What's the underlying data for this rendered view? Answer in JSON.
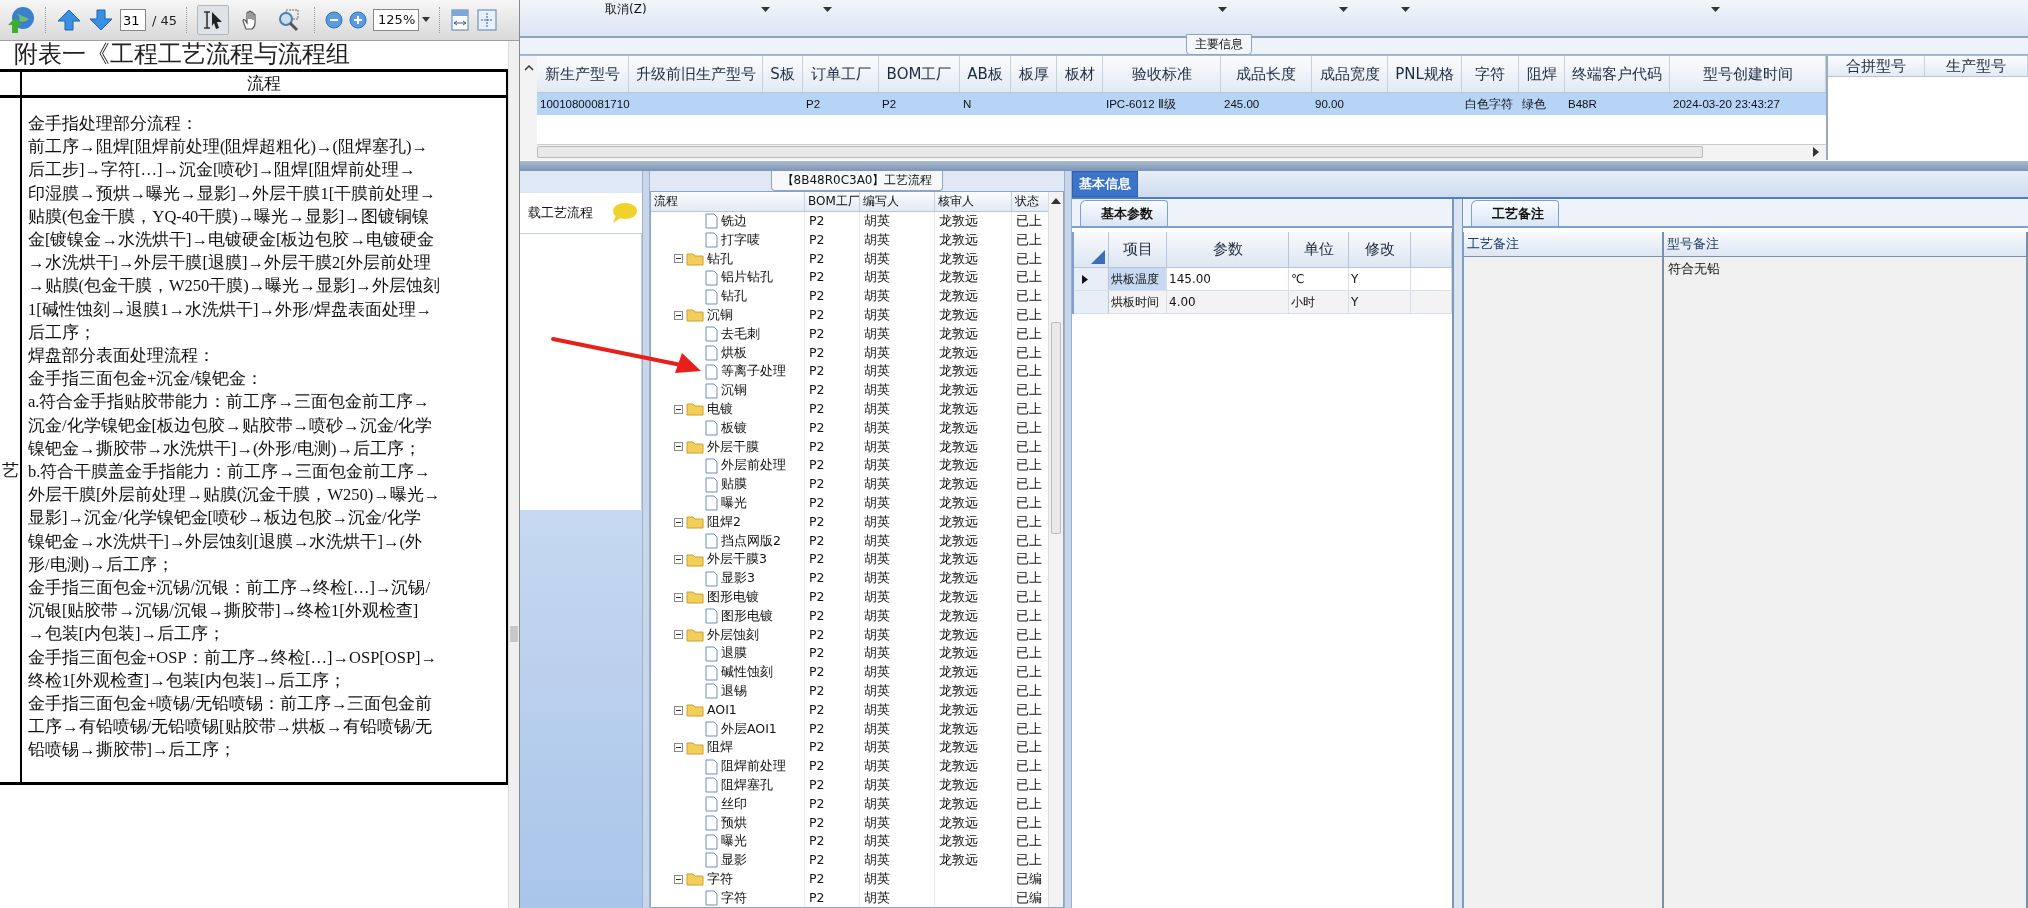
{
  "pdf_viewer": {
    "toolbar": {
      "page": "31",
      "page_total": "/ 45",
      "zoom": "125%",
      "tools": [
        {
          "kind": "select",
          "selected": true
        },
        {
          "kind": "hand",
          "selected": false
        },
        {
          "kind": "marquee-zoom",
          "selected": false
        }
      ]
    },
    "document": {
      "title": "附表一《工程工艺流程与流程组",
      "table_header": "流程",
      "side_text": "艺",
      "lines": [
        "金手指处理部分流程：",
        "前工序→阻焊[阻焊前处理(阻焊超粗化)→(阻焊塞孔)→",
        "后工步]→字符[…]→沉金[喷砂]→阻焊[阻焊前处理→",
        "印湿膜→预烘→曝光→显影]→外层干膜1[干膜前处理→",
        "贴膜(包金干膜，YQ-40干膜)→曝光→显影]→图镀铜镍",
        "金[镀镍金→水洗烘干]→电镀硬金[板边包胶→电镀硬金",
        "→水洗烘干]→外层干膜[退膜]→外层干膜2[外层前处理",
        "→贴膜(包金干膜，W250干膜)→曝光→显影]→外层蚀刻",
        "1[碱性蚀刻→退膜1→水洗烘干]→外形/焊盘表面处理→",
        "后工序；",
        "焊盘部分表面处理流程：",
        "金手指三面包金+沉金/镍钯金：",
        "a.符合金手指贴胶带能力：前工序→三面包金前工序→",
        "沉金/化学镍钯金[板边包胶→贴胶带→喷砂→沉金/化学",
        "镍钯金→撕胶带→水洗烘干]→(外形/电测)→后工序；",
        "b.符合干膜盖金手指能力：前工序→三面包金前工序→",
        "外层干膜[外层前处理→贴膜(沉金干膜，W250)→曝光→",
        "显影]→沉金/化学镍钯金[喷砂→板边包胶→沉金/化学",
        "镍钯金→水洗烘干]→外层蚀刻[退膜→水洗烘干]→(外",
        "形/电测)→后工序；",
        "金手指三面包金+沉锡/沉银：前工序→终检[…]→沉锡/",
        "沉银[贴胶带→沉锡/沉银→撕胶带]→终检1[外观检查]",
        "→包装[内包装]→后工序；",
        "金手指三面包金+OSP：前工序→终检[…]→OSP[OSP]→",
        "终检1[外观检查]→包装[内包装]→后工序；",
        "金手指三面包金+喷锡/无铅喷锡：前工序→三面包金前",
        "工序→有铅喷锡/无铅喷锡[贴胶带→烘板→有铅喷锡/无",
        "铅喷锡→撕胶带]→后工序；"
      ]
    }
  },
  "app": {
    "toolbar": {
      "cancel_menu": "取消(Z)"
    },
    "main_info": {
      "label": "主要信息",
      "columns": [
        "新生产型号",
        "升级前旧生产型号",
        "S板",
        "订单工厂",
        "BOM工厂",
        "AB板",
        "板厚",
        "板材",
        "验收标准",
        "成品长度",
        "成品宽度",
        "PNL规格",
        "字符",
        "阻焊",
        "终端客户代码",
        "型号创建时间"
      ],
      "rows": [
        {
          "selected": true,
          "cells": [
            "10010800081710",
            null,
            null,
            "P2",
            "P2",
            "N",
            null,
            null,
            "IPC-6012 Ⅱ级",
            "245.00",
            "90.00",
            null,
            "白色字符",
            "绿色",
            "B48R",
            "2024-03-20 23:43:27"
          ]
        }
      ],
      "side_columns": [
        "合拼型号",
        "生产型号"
      ]
    },
    "left_panel": {
      "title": "载工艺流程"
    },
    "process_flow": {
      "title": "【8B48R0C3A0】工艺流程",
      "columns": [
        "流程",
        "BOM工厂",
        "编写人",
        "核审人",
        "状态"
      ],
      "rows": [
        {
          "children": [
            {
              "kind": "step",
              "label": "铣边",
              "bom": "P2",
              "writer": "胡英",
              "reviewer": "龙敦远",
              "status": "已上"
            },
            {
              "kind": "step",
              "label": "打字唛",
              "bom": "P2",
              "writer": "胡英",
              "reviewer": "龙敦远",
              "status": "已上"
            }
          ]
        },
        {
          "kind": "folder",
          "expanded": true,
          "label": "钻孔",
          "bom": "P2",
          "writer": "胡英",
          "reviewer": "龙敦远",
          "status": "已上",
          "children": [
            {
              "kind": "step",
              "label": "铝片钻孔",
              "bom": "P2",
              "writer": "胡英",
              "reviewer": "龙敦远",
              "status": "已上"
            },
            {
              "kind": "step",
              "label": "钻孔",
              "bom": "P2",
              "writer": "胡英",
              "reviewer": "龙敦远",
              "status": "已上"
            }
          ]
        },
        {
          "kind": "folder",
          "expanded": true,
          "label": "沉铜",
          "bom": "P2",
          "writer": "胡英",
          "reviewer": "龙敦远",
          "status": "已上",
          "children": [
            {
              "kind": "step",
              "label": "去毛刺",
              "bom": "P2",
              "writer": "胡英",
              "reviewer": "龙敦远",
              "status": "已上"
            },
            {
              "kind": "step",
              "label": "烘板",
              "bom": "P2",
              "writer": "胡英",
              "reviewer": "龙敦远",
              "status": "已上"
            },
            {
              "kind": "step",
              "label": "等离子处理",
              "bom": "P2",
              "writer": "胡英",
              "reviewer": "龙敦远",
              "status": "已上"
            },
            {
              "kind": "step",
              "label": "沉铜",
              "bom": "P2",
              "writer": "胡英",
              "reviewer": "龙敦远",
              "status": "已上"
            }
          ]
        },
        {
          "kind": "folder",
          "expanded": true,
          "label": "电镀",
          "bom": "P2",
          "writer": "胡英",
          "reviewer": "龙敦远",
          "status": "已上",
          "children": [
            {
              "kind": "step",
              "label": "板镀",
              "bom": "P2",
              "writer": "胡英",
              "reviewer": "龙敦远",
              "status": "已上"
            }
          ]
        },
        {
          "kind": "folder",
          "expanded": true,
          "label": "外层干膜",
          "bom": "P2",
          "writer": "胡英",
          "reviewer": "龙敦远",
          "status": "已上",
          "children": [
            {
              "kind": "step",
              "label": "外层前处理",
              "bom": "P2",
              "writer": "胡英",
              "reviewer": "龙敦远",
              "status": "已上"
            },
            {
              "kind": "step",
              "label": "贴膜",
              "bom": "P2",
              "writer": "胡英",
              "reviewer": "龙敦远",
              "status": "已上"
            },
            {
              "kind": "step",
              "label": "曝光",
              "bom": "P2",
              "writer": "胡英",
              "reviewer": "龙敦远",
              "status": "已上"
            }
          ]
        },
        {
          "kind": "folder",
          "expanded": true,
          "label": "阻焊2",
          "bom": "P2",
          "writer": "胡英",
          "reviewer": "龙敦远",
          "status": "已上",
          "children": [
            {
              "kind": "step",
              "label": "挡点网版2",
              "bom": "P2",
              "writer": "胡英",
              "reviewer": "龙敦远",
              "status": "已上"
            }
          ]
        },
        {
          "kind": "folder",
          "expanded": true,
          "label": "外层干膜3",
          "bom": "P2",
          "writer": "胡英",
          "reviewer": "龙敦远",
          "status": "已上",
          "children": [
            {
              "kind": "step",
              "label": "显影3",
              "bom": "P2",
              "writer": "胡英",
              "reviewer": "龙敦远",
              "status": "已上"
            }
          ]
        },
        {
          "kind": "folder",
          "expanded": true,
          "label": "图形电镀",
          "bom": "P2",
          "writer": "胡英",
          "reviewer": "龙敦远",
          "status": "已上",
          "children": [
            {
              "kind": "step",
              "label": "图形电镀",
              "bom": "P2",
              "writer": "胡英",
              "reviewer": "龙敦远",
              "status": "已上"
            }
          ]
        },
        {
          "kind": "folder",
          "expanded": true,
          "label": "外层蚀刻",
          "bom": "P2",
          "writer": "胡英",
          "reviewer": "龙敦远",
          "status": "已上",
          "children": [
            {
              "kind": "step",
              "label": "退膜",
              "bom": "P2",
              "writer": "胡英",
              "reviewer": "龙敦远",
              "status": "已上"
            },
            {
              "kind": "step",
              "label": "碱性蚀刻",
              "bom": "P2",
              "writer": "胡英",
              "reviewer": "龙敦远",
              "status": "已上"
            },
            {
              "kind": "step",
              "label": "退锡",
              "bom": "P2",
              "writer": "胡英",
              "reviewer": "龙敦远",
              "status": "已上"
            }
          ]
        },
        {
          "kind": "folder",
          "expanded": true,
          "label": "AOI1",
          "bom": "P2",
          "writer": "胡英",
          "reviewer": "龙敦远",
          "status": "已上",
          "children": [
            {
              "kind": "step",
              "label": "外层AOI1",
              "bom": "P2",
              "writer": "胡英",
              "reviewer": "龙敦远",
              "status": "已上"
            }
          ]
        },
        {
          "kind": "folder",
          "expanded": true,
          "label": "阻焊",
          "bom": "P2",
          "writer": "胡英",
          "reviewer": "龙敦远",
          "status": "已上",
          "children": [
            {
              "kind": "step",
              "label": "阻焊前处理",
              "bom": "P2",
              "writer": "胡英",
              "reviewer": "龙敦远",
              "status": "已上"
            },
            {
              "kind": "step",
              "label": "阻焊塞孔",
              "bom": "P2",
              "writer": "胡英",
              "reviewer": "龙敦远",
              "status": "已上"
            },
            {
              "kind": "step",
              "label": "丝印",
              "bom": "P2",
              "writer": "胡英",
              "reviewer": "龙敦远",
              "status": "已上"
            },
            {
              "kind": "step",
              "label": "预烘",
              "bom": "P2",
              "writer": "胡英",
              "reviewer": "龙敦远",
              "status": "已上"
            },
            {
              "kind": "step",
              "label": "曝光",
              "bom": "P2",
              "writer": "胡英",
              "reviewer": "龙敦远",
              "status": "已上"
            },
            {
              "kind": "step",
              "label": "显影",
              "bom": "P2",
              "writer": "胡英",
              "reviewer": "龙敦远",
              "status": "已上"
            }
          ]
        },
        {
          "kind": "folder",
          "expanded": true,
          "label": "字符",
          "bom": "P2",
          "writer": "胡英",
          "status": "已编",
          "children": [
            {
              "kind": "step",
              "label": "字符",
              "bom": "P2",
              "writer": "胡英",
              "status": "已编"
            }
          ]
        }
      ]
    },
    "detail": {
      "tabs": [
        {
          "label": "基本信息",
          "selected": true
        }
      ],
      "params": {
        "tab": "基本参数",
        "columns": [
          "项目",
          "参数",
          "单位",
          "修改"
        ],
        "rows": [
          {
            "selected": true,
            "cells": [
              "烘板温度",
              "145.00",
              "℃",
              "Y"
            ]
          },
          {
            "selected": false,
            "cells": [
              "烘板时间",
              "4.00",
              "小时",
              "Y"
            ]
          }
        ]
      },
      "notes": {
        "tab": "工艺备注",
        "columns": [
          "工艺备注",
          "型号备注"
        ],
        "rows": [
          {
            "cells": [
              null,
              "符合无铅"
            ]
          }
        ]
      }
    }
  }
}
